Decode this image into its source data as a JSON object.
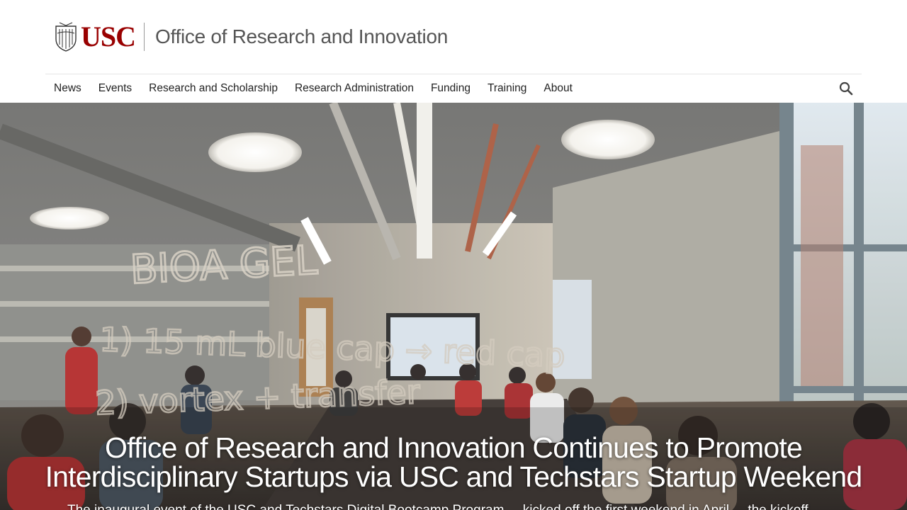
{
  "header": {
    "logo_text": "USC",
    "office_title": "Office of Research and Innovation"
  },
  "nav": {
    "items": [
      {
        "label": "News"
      },
      {
        "label": "Events"
      },
      {
        "label": "Research and Scholarship"
      },
      {
        "label": "Research Administration"
      },
      {
        "label": "Funding"
      },
      {
        "label": "Training"
      },
      {
        "label": "About"
      }
    ],
    "search_icon": "search-icon"
  },
  "hero": {
    "title_line1": "Office of Research and Innovation Continues to Promote",
    "title_line2": "Interdisciplinary Startups via USC and Techstars Startup Weekend",
    "subtitle": "The inaugural event of the USC and Techstars Digital Bootcamp Program ... kicked off the first weekend in April ... the kickoff",
    "glass_writing": [
      "BIOA GEL",
      "1) 15 mL blue cap → red cap",
      "2) vortex + transfer"
    ]
  },
  "colors": {
    "brand_red": "#990000",
    "nav_text": "#222222",
    "title_gray": "#555555"
  }
}
